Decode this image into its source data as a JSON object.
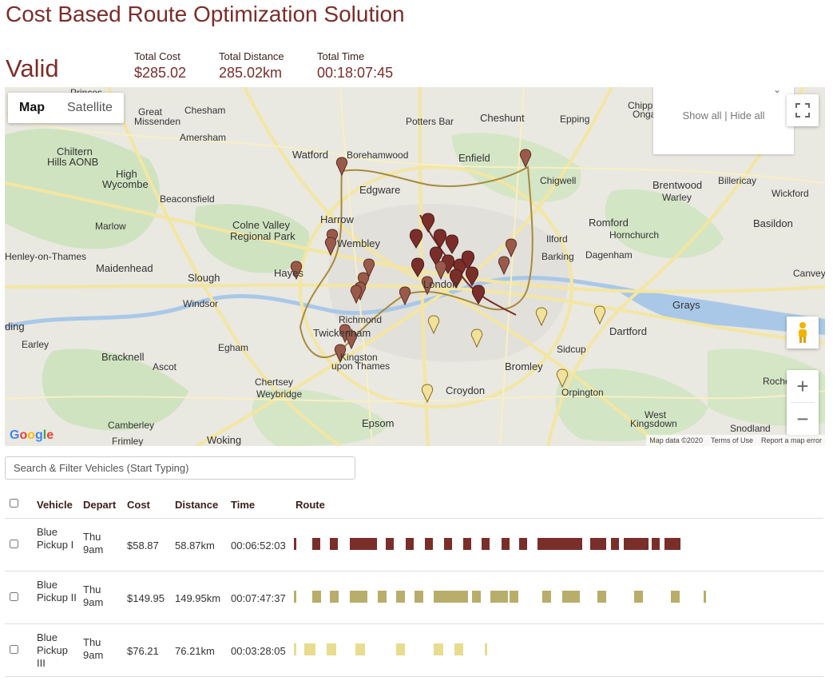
{
  "page": {
    "title": "Cost Based Route Optimization Solution"
  },
  "summary": {
    "status": "Valid",
    "metrics": [
      {
        "label": "Total Cost",
        "value": "$285.02"
      },
      {
        "label": "Total Distance",
        "value": "285.02km"
      },
      {
        "label": "Total Time",
        "value": "00:18:07:45"
      }
    ]
  },
  "map": {
    "type_controls": [
      "Map",
      "Satellite"
    ],
    "active_type": "Map",
    "legend": {
      "show_all": "Show all",
      "separator": " | ",
      "hide_all": "Hide all"
    },
    "zoom_in": "+",
    "zoom_out": "−",
    "attribution": {
      "data": "Map data ©2020",
      "terms": "Terms of Use",
      "report": "Report a map error"
    },
    "logo_text": [
      "G",
      "o",
      "o",
      "g",
      "l",
      "e"
    ],
    "places": [
      {
        "name": "Princes",
        "cls": ""
      },
      {
        "name": "Great",
        "cls": ""
      },
      {
        "name": "Missenden",
        "cls": ""
      },
      {
        "name": "Chesham",
        "cls": ""
      },
      {
        "name": "Amersham",
        "cls": ""
      },
      {
        "name": "Chiltern",
        "cls": "big"
      },
      {
        "name": "Hills AONB",
        "cls": "big"
      },
      {
        "name": "High",
        "cls": "big"
      },
      {
        "name": "Wycombe",
        "cls": "big"
      },
      {
        "name": "Beaconsfield",
        "cls": ""
      },
      {
        "name": "Marlow",
        "cls": ""
      },
      {
        "name": "Watford",
        "cls": "big"
      },
      {
        "name": "Borehamwood",
        "cls": ""
      },
      {
        "name": "Potters Bar",
        "cls": ""
      },
      {
        "name": "Cheshunt",
        "cls": "big"
      },
      {
        "name": "Epping",
        "cls": ""
      },
      {
        "name": "Chipping",
        "cls": ""
      },
      {
        "name": "Ongar",
        "cls": ""
      },
      {
        "name": "Enfield",
        "cls": "big"
      },
      {
        "name": "Edgware",
        "cls": "big"
      },
      {
        "name": "Chigwell",
        "cls": ""
      },
      {
        "name": "Brentwood",
        "cls": "big"
      },
      {
        "name": "Warley",
        "cls": ""
      },
      {
        "name": "Billericay",
        "cls": ""
      },
      {
        "name": "Wickford",
        "cls": ""
      },
      {
        "name": "Harrow",
        "cls": "big"
      },
      {
        "name": "Colne Valley",
        "cls": "big"
      },
      {
        "name": "Regional Park",
        "cls": "big"
      },
      {
        "name": "Wembley",
        "cls": "big"
      },
      {
        "name": "Romford",
        "cls": "big"
      },
      {
        "name": "Basildon",
        "cls": "big"
      },
      {
        "name": "Ilford",
        "cls": ""
      },
      {
        "name": "Hornchurch",
        "cls": ""
      },
      {
        "name": "Henley-on-Thames",
        "cls": ""
      },
      {
        "name": "Maidenhead",
        "cls": "big"
      },
      {
        "name": "Barking",
        "cls": ""
      },
      {
        "name": "Dagenham",
        "cls": ""
      },
      {
        "name": "Slough",
        "cls": "big"
      },
      {
        "name": "Hayes",
        "cls": "big"
      },
      {
        "name": "Canvey I",
        "cls": ""
      },
      {
        "name": "Windsor",
        "cls": ""
      },
      {
        "name": "Grays",
        "cls": "big"
      },
      {
        "name": "ding",
        "cls": "big"
      },
      {
        "name": "Richmond",
        "cls": ""
      },
      {
        "name": "Twickenham",
        "cls": "big"
      },
      {
        "name": "Dartford",
        "cls": "big"
      },
      {
        "name": "Earley",
        "cls": ""
      },
      {
        "name": "Egham",
        "cls": ""
      },
      {
        "name": "Sidcup",
        "cls": ""
      },
      {
        "name": "Bracknell",
        "cls": "big"
      },
      {
        "name": "Ascot",
        "cls": ""
      },
      {
        "name": "Kingston",
        "cls": ""
      },
      {
        "name": "upon Thames",
        "cls": ""
      },
      {
        "name": "Bromley",
        "cls": "big"
      },
      {
        "name": "Chertsey",
        "cls": ""
      },
      {
        "name": "Weybridge",
        "cls": ""
      },
      {
        "name": "Croydon",
        "cls": "big"
      },
      {
        "name": "Orpington",
        "cls": ""
      },
      {
        "name": "Roches",
        "cls": ""
      },
      {
        "name": "Camberley",
        "cls": ""
      },
      {
        "name": "Epsom",
        "cls": "big"
      },
      {
        "name": "West",
        "cls": ""
      },
      {
        "name": "Kingsdown",
        "cls": ""
      },
      {
        "name": "Snodland",
        "cls": ""
      },
      {
        "name": "Frimley",
        "cls": ""
      },
      {
        "name": "Woking",
        "cls": "big"
      },
      {
        "name": "London",
        "cls": "big"
      }
    ]
  },
  "search": {
    "placeholder": "Search & Filter Vehicles (Start Typing)"
  },
  "table": {
    "headers": {
      "vehicle": "Vehicle",
      "depart": "Depart",
      "cost": "Cost",
      "distance": "Distance",
      "time": "Time",
      "route": "Route"
    },
    "rows": [
      {
        "vehicle": "Blue Pickup I",
        "depart": "Thu 9am",
        "cost": "$58.87",
        "distance": "58.87km",
        "time": "00:06:52:03",
        "color": "#7a2e2a",
        "route": [
          [
            0,
            0.005,
            "e"
          ],
          [
            0.039,
            0.016,
            "s"
          ],
          [
            0.075,
            0.016,
            "s"
          ],
          [
            0.116,
            0.057,
            "s"
          ],
          [
            0.192,
            0.016,
            "s"
          ],
          [
            0.233,
            0.016,
            "s"
          ],
          [
            0.273,
            0.016,
            "s"
          ],
          [
            0.313,
            0.016,
            "s"
          ],
          [
            0.353,
            0.016,
            "s"
          ],
          [
            0.392,
            0.016,
            "s"
          ],
          [
            0.433,
            0.016,
            "s"
          ],
          [
            0.47,
            0.016,
            "s"
          ],
          [
            0.508,
            0.093,
            "s"
          ],
          [
            0.618,
            0.034,
            "s"
          ],
          [
            0.661,
            0.016,
            "s"
          ],
          [
            0.688,
            0.051,
            "s"
          ],
          [
            0.747,
            0.016,
            "s"
          ],
          [
            0.773,
            0.034,
            "s"
          ],
          [
            0.79,
            0.005,
            "e"
          ]
        ]
      },
      {
        "vehicle": "Blue Pickup II",
        "depart": "Thu 9am",
        "cost": "$149.95",
        "distance": "149.95km",
        "time": "00:07:47:37",
        "color": "#b8ad6a",
        "route": [
          [
            0,
            0.005,
            "e"
          ],
          [
            0.039,
            0.018,
            "s"
          ],
          [
            0.075,
            0.018,
            "s"
          ],
          [
            0.116,
            0.036,
            "s"
          ],
          [
            0.175,
            0.018,
            "s"
          ],
          [
            0.213,
            0.018,
            "s"
          ],
          [
            0.252,
            0.018,
            "s"
          ],
          [
            0.292,
            0.072,
            "s"
          ],
          [
            0.372,
            0.018,
            "s"
          ],
          [
            0.41,
            0.036,
            "s"
          ],
          [
            0.45,
            0.018,
            "s"
          ],
          [
            0.519,
            0.018,
            "s"
          ],
          [
            0.56,
            0.036,
            "s"
          ],
          [
            0.633,
            0.018,
            "s"
          ],
          [
            0.71,
            0.018,
            "s"
          ],
          [
            0.787,
            0.018,
            "s"
          ],
          [
            0.855,
            0.005,
            "e"
          ]
        ]
      },
      {
        "vehicle": "Blue Pickup III",
        "depart": "Thu 9am",
        "cost": "$76.21",
        "distance": "76.21km",
        "time": "00:03:28:05",
        "color": "#e8dc8e",
        "route": [
          [
            0,
            0.005,
            "e"
          ],
          [
            0.022,
            0.024,
            "s"
          ],
          [
            0.068,
            0.02,
            "s"
          ],
          [
            0.128,
            0.02,
            "s"
          ],
          [
            0.213,
            0.018,
            "s"
          ],
          [
            0.291,
            0.02,
            "s"
          ],
          [
            0.335,
            0.018,
            "s"
          ],
          [
            0.398,
            0.005,
            "e"
          ]
        ]
      }
    ]
  }
}
